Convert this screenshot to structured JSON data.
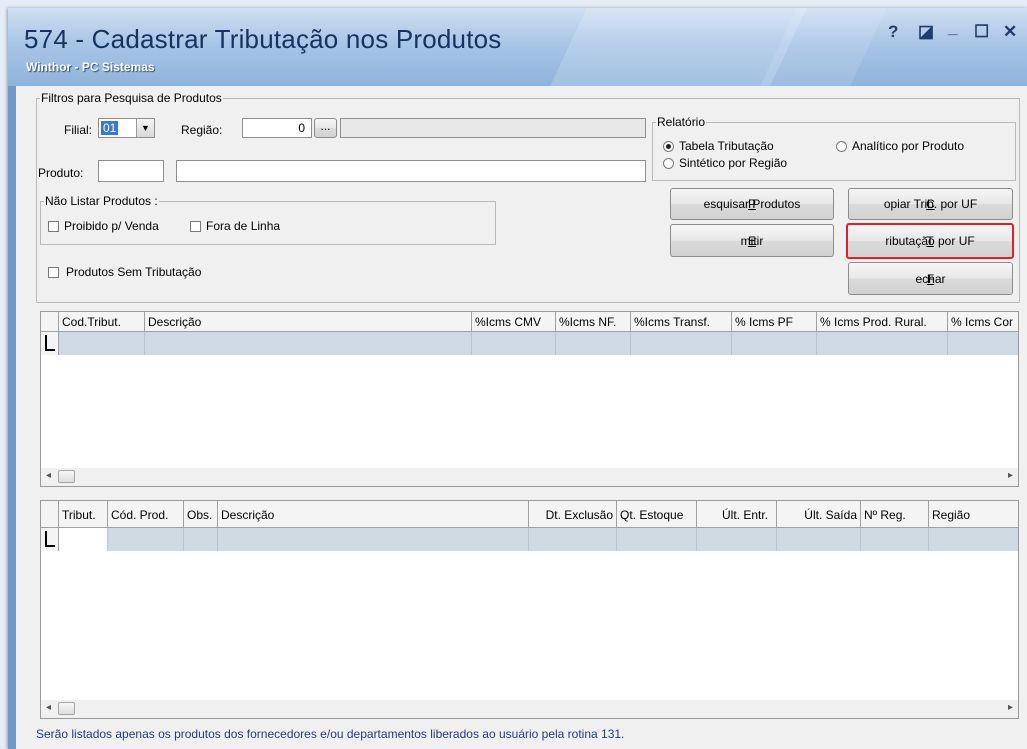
{
  "window": {
    "title": "574 - Cadastrar Tributação nos Produtos",
    "subtitle": "Winthor - PC Sistemas",
    "controls": {
      "help": "?",
      "restore": "◪",
      "minimize": "_",
      "maximize": "☐",
      "close": "✕"
    }
  },
  "filters": {
    "legend": "Filtros para Pesquisa de Produtos",
    "filial_label": "Filial:",
    "filial_value": "01",
    "regiao_label": "Região:",
    "regiao_value": "0",
    "regiao_lookup": "...",
    "regiao_desc": "",
    "produto_label": "Produto:",
    "produto_code": "",
    "produto_desc": "",
    "nao_listar": {
      "legend": "Não Listar Produtos :",
      "proibido": "Proibido p/ Venda",
      "fora_linha": "Fora de Linha"
    },
    "sem_tributacao": "Produtos Sem Tributação"
  },
  "relatorio": {
    "legend": "Relatório",
    "opt1": "Tabela Tributação",
    "opt2": "Analítico por Produto",
    "opt3": "Sintético por Região",
    "selected": "Tabela Tributação"
  },
  "buttons": {
    "pesquisar": {
      "u": "P",
      "rest": "esquisar Produtos"
    },
    "copiar": {
      "u": "C",
      "rest": "opiar Trib. por UF"
    },
    "emitir": {
      "pre": "",
      "u": "E",
      "rest": "mitir"
    },
    "tributacao": {
      "u": "T",
      "rest": "ributação por UF"
    },
    "fechar": {
      "u": "F",
      "rest": "echar"
    }
  },
  "grid1": {
    "columns": [
      "Cod.Tribut.",
      "Descrição",
      "%Icms CMV",
      "%Icms NF.",
      "%Icms Transf.",
      "% Icms PF",
      "% Icms Prod. Rural.",
      "% Icms Cor"
    ]
  },
  "grid2": {
    "columns": [
      "Tribut.",
      "Cód. Prod.",
      "Obs.",
      "Descrição",
      "Dt. Exclusão",
      "Qt. Estoque",
      "Últ. Entr.",
      "Últ. Saída",
      "Nº Reg.",
      "Região"
    ]
  },
  "status": "Serão listados apenas os produtos dos fornecedores e/ou departamentos liberados ao usuário pela rotina 131.",
  "colors": {
    "title": "#16325f",
    "highlight": "#e0202a",
    "status_text": "#1f3a8a",
    "grid_row": "#cfd9e4"
  }
}
